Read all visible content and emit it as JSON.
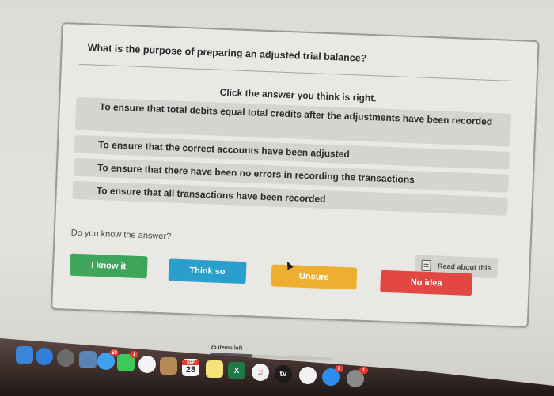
{
  "quiz": {
    "question": "What is the purpose of preparing an adjusted trial balance?",
    "instruction": "Click the answer you think is right.",
    "options": [
      {
        "label": "To ensure that total debits equal total credits after the adjustments have been recorded"
      },
      {
        "label": "To ensure that the correct accounts have been adjusted"
      },
      {
        "label": "To ensure that there have been no errors in recording the transactions"
      },
      {
        "label": "To ensure that all transactions have been recorded"
      }
    ],
    "confidence_prompt": "Do you know the answer?",
    "read_about_label": "Read about this",
    "confidence_buttons": [
      {
        "label": "I know it",
        "color": "#3ea55a"
      },
      {
        "label": "Think so",
        "color": "#2a9fcb"
      },
      {
        "label": "Unsure",
        "color": "#eeaf30"
      },
      {
        "label": "No idea",
        "color": "#e24741"
      }
    ]
  },
  "progress": {
    "label": "25 items left",
    "fraction_complete": 0.35
  },
  "dock": {
    "apps": [
      {
        "name": "Finder",
        "icon": "finder-icon"
      },
      {
        "name": "Safari",
        "icon": "safari-icon"
      },
      {
        "name": "Launchpad",
        "icon": "rocket-icon"
      },
      {
        "name": "Preview",
        "icon": "preview-icon"
      },
      {
        "name": "Messages",
        "icon": "messages-icon",
        "badge": "58"
      },
      {
        "name": "FaceTime",
        "icon": "facetime-icon",
        "badge": "1"
      },
      {
        "name": "Photos",
        "icon": "photos-icon"
      },
      {
        "name": "Contacts",
        "icon": "contacts-icon"
      },
      {
        "name": "Calendar",
        "icon": "calendar-icon",
        "month": "SEP",
        "day": "28"
      },
      {
        "name": "Notes",
        "icon": "notes-icon"
      },
      {
        "name": "Excel",
        "icon": "excel-icon",
        "glyph": "X"
      },
      {
        "name": "Music",
        "icon": "music-icon",
        "glyph": "♫"
      },
      {
        "name": "TV",
        "icon": "tv-icon",
        "glyph": "tv"
      },
      {
        "name": "News",
        "icon": "news-icon"
      },
      {
        "name": "App Store",
        "icon": "app-store-icon",
        "badge": "8"
      },
      {
        "name": "System Preferences",
        "icon": "settings-icon",
        "badge": "1"
      }
    ]
  }
}
